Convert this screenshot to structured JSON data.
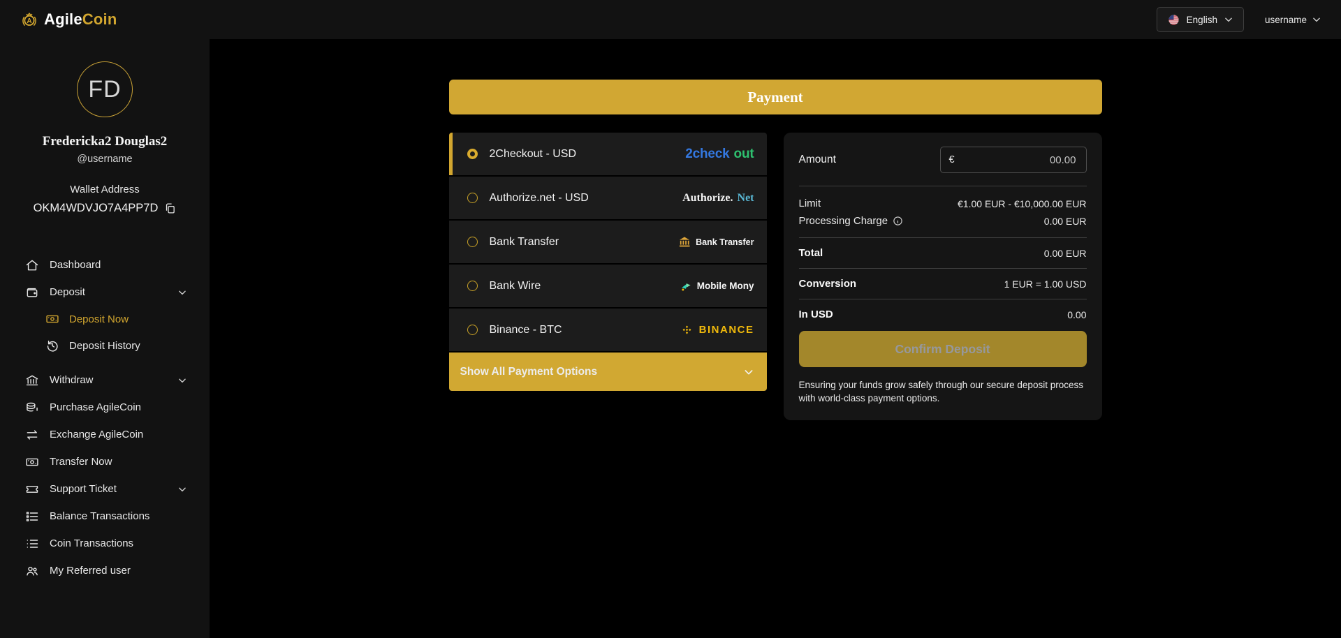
{
  "header": {
    "brand": {
      "crest_letter": "A",
      "name_primary": "Agile",
      "name_secondary": "Coin"
    },
    "language": {
      "label": "English"
    },
    "user": {
      "label": "username"
    }
  },
  "sidebar": {
    "profile": {
      "avatar_initials": "FD",
      "name": "Fredericka2 Douglas2",
      "handle": "@username",
      "wallet_label": "Wallet Address",
      "wallet_address": "OKM4WDVJO7A4PP7D"
    },
    "menu": [
      {
        "id": "dashboard",
        "label": "Dashboard",
        "icon": "home-icon"
      },
      {
        "id": "deposit",
        "label": "Deposit",
        "icon": "wallet-icon",
        "expanded": true,
        "children": [
          {
            "id": "deposit-now",
            "label": "Deposit Now",
            "icon": "banknote-icon",
            "active": true
          },
          {
            "id": "deposit-history",
            "label": "Deposit History",
            "icon": "history-icon",
            "active": false
          }
        ]
      },
      {
        "id": "withdraw",
        "label": "Withdraw",
        "icon": "bank-icon",
        "expandable": true
      },
      {
        "id": "purchase-agilecoin",
        "label": "Purchase AgileCoin",
        "icon": "coins-icon"
      },
      {
        "id": "exchange-agilecoin",
        "label": "Exchange AgileCoin",
        "icon": "swap-icon"
      },
      {
        "id": "transfer-now",
        "label": "Transfer Now",
        "icon": "banknote-icon"
      },
      {
        "id": "support-ticket",
        "label": "Support Ticket",
        "icon": "ticket-icon",
        "expandable": true
      },
      {
        "id": "balance-transactions",
        "label": "Balance Transactions",
        "icon": "list-check-icon"
      },
      {
        "id": "coin-transactions",
        "label": "Coin Transactions",
        "icon": "list-icon"
      },
      {
        "id": "my-referred-user",
        "label": "My Referred user",
        "icon": "users-icon"
      }
    ]
  },
  "payment": {
    "title": "Payment",
    "show_all_label": "Show All Payment Options",
    "methods": [
      {
        "label": "2Checkout - USD",
        "selected": true,
        "logo": "2checkout-logo"
      },
      {
        "label": "Authorize.net - USD",
        "selected": false,
        "logo": "authorize-net-logo"
      },
      {
        "label": "Bank Transfer",
        "selected": false,
        "logo": "bank-transfer-logo"
      },
      {
        "label": "Bank Wire",
        "selected": false,
        "logo": "mobile-mony-logo"
      },
      {
        "label": "Binance - BTC",
        "selected": false,
        "logo": "binance-logo"
      }
    ],
    "logos": {
      "twocheckout": {
        "blue": "2check",
        "green": "out"
      },
      "authorize": {
        "white": "Authorize.",
        "teal": "Net"
      },
      "bank_transfer": {
        "label": "Bank Transfer"
      },
      "mobile_mony": {
        "label": "Mobile Mony"
      },
      "binance": {
        "label": "BINANCE"
      }
    }
  },
  "summary": {
    "amount_label": "Amount",
    "currency_symbol": "€",
    "amount_placeholder": "00.00",
    "rows": [
      {
        "label": "Limit",
        "value": "€1.00 EUR - €10,000.00 EUR"
      },
      {
        "label": "Processing Charge",
        "value": "0.00 EUR"
      },
      {
        "label": "Total",
        "value": "0.00 EUR"
      },
      {
        "label": "Conversion",
        "value": "1 EUR = 1.00 USD"
      },
      {
        "label": "In USD",
        "value": "0.00"
      }
    ],
    "confirm_label": "Confirm Deposit",
    "note": "Ensuring your funds grow safely through our secure deposit process with world-class payment options."
  },
  "colors": {
    "background": "#000000",
    "panel": "#121212",
    "card": "#151515",
    "list_item": "#1c1c1c",
    "accent_gold": "#d2a62f",
    "header_gold": "#d1a733",
    "confirm_gold": "#a3872b",
    "binance_gold": "#f0b90b",
    "logo_blue": "#3478e0",
    "logo_green": "#2ec06f",
    "authorize_teal": "#59b7d3"
  }
}
